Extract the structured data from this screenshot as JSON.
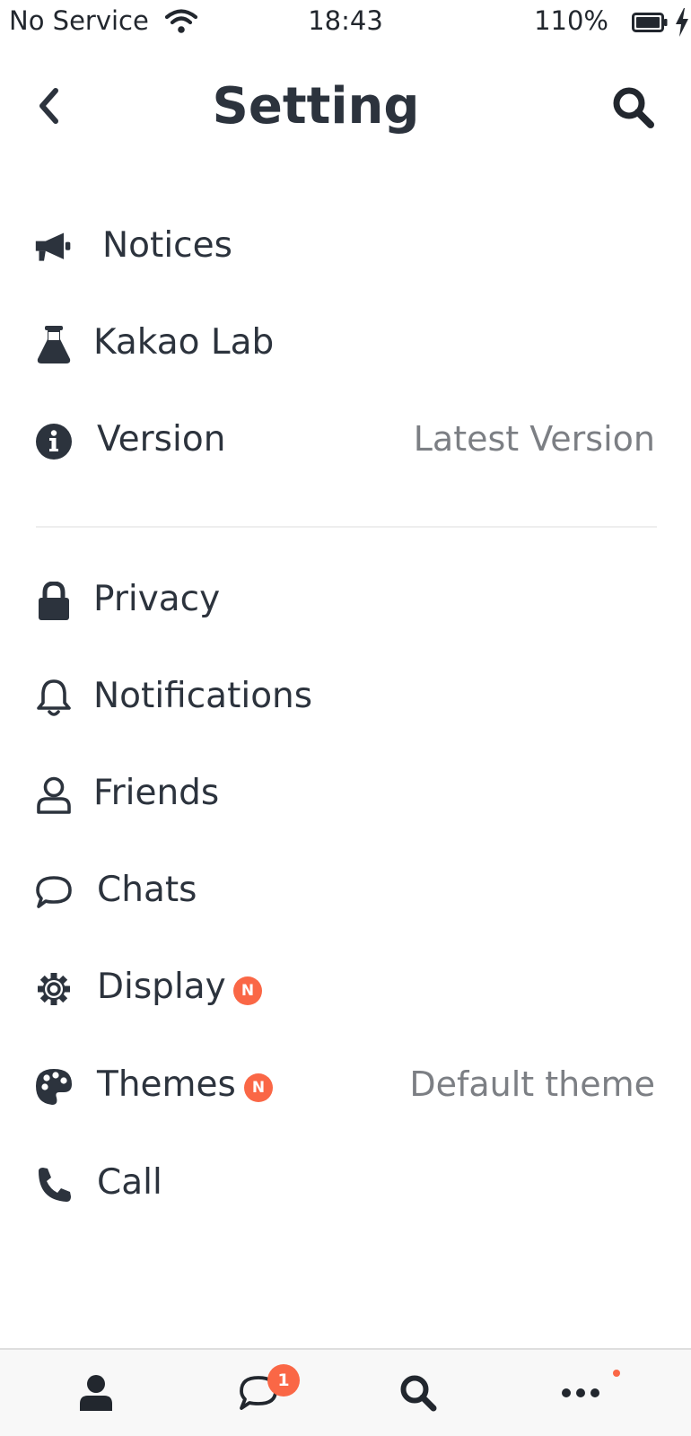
{
  "status_bar": {
    "carrier": "No Service",
    "time": "18:43",
    "battery": "110%",
    "icons": [
      "wifi-icon",
      "battery-icon",
      "charging-bolt-icon"
    ]
  },
  "header": {
    "title": "Setting",
    "back_icon": "chevron-left-icon",
    "search_icon": "search-icon"
  },
  "settings": {
    "items": [
      {
        "label": "Notices",
        "icon": "megaphone-icon"
      },
      {
        "label": "Kakao Lab",
        "icon": "flask-icon"
      },
      {
        "label": "Version",
        "icon": "info-icon",
        "value": "Latest Version"
      },
      {
        "label": "Privacy",
        "icon": "lock-icon"
      },
      {
        "label": "Notifications",
        "icon": "bell-icon"
      },
      {
        "label": "Friends",
        "icon": "person-icon"
      },
      {
        "label": "Chats",
        "icon": "chat-bubble-icon"
      },
      {
        "label": "Display",
        "icon": "gear-icon",
        "badge": "N"
      },
      {
        "label": "Themes",
        "icon": "palette-icon",
        "badge": "N",
        "value": "Default theme"
      },
      {
        "label": "Call",
        "icon": "phone-icon"
      }
    ]
  },
  "tab_bar": {
    "tabs": [
      {
        "name": "friends",
        "icon": "person-icon"
      },
      {
        "name": "chats",
        "icon": "chat-bubble-icon",
        "badge": "1"
      },
      {
        "name": "search",
        "icon": "search-icon"
      },
      {
        "name": "more",
        "icon": "more-dots-icon"
      }
    ]
  },
  "colors": {
    "text": "#2c333d",
    "secondary_text": "#7c7f84",
    "badge": "#fa6746",
    "divider": "#eeeeee",
    "tab_bar_bg": "#f8f8f8"
  }
}
